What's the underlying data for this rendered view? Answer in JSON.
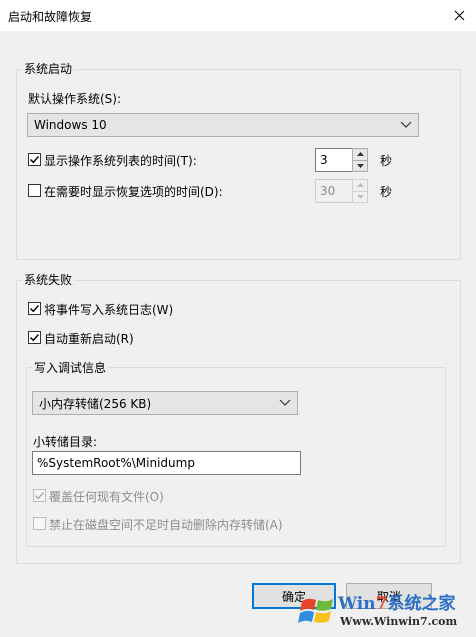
{
  "window": {
    "title": "启动和故障恢复",
    "close_icon": "close-icon"
  },
  "system_startup": {
    "group_title": "系统启动",
    "default_os_label": "默认操作系统(S):",
    "default_os_value": "Windows 10",
    "show_os_list": {
      "label": "显示操作系统列表的时间(T):",
      "checked": true,
      "value": "3",
      "unit": "秒"
    },
    "show_recovery": {
      "label": "在需要时显示恢复选项的时间(D):",
      "checked": false,
      "value": "30",
      "unit": "秒"
    }
  },
  "system_failure": {
    "group_title": "系统失败",
    "write_event": {
      "label": "将事件写入系统日志(W)",
      "checked": true
    },
    "auto_restart": {
      "label": "自动重新启动(R)",
      "checked": true
    },
    "debug_info": {
      "group_title": "写入调试信息",
      "dump_type": "小内存转储(256 KB)",
      "dump_dir_label": "小转储目录:",
      "dump_dir_value": "%SystemRoot%\\Minidump",
      "overwrite": {
        "label": "覆盖任何现有文件(O)",
        "checked": true,
        "disabled": true
      },
      "disable_auto_delete": {
        "label": "禁止在磁盘空间不足时自动删除内存转储(A)",
        "checked": false,
        "disabled": true
      }
    }
  },
  "buttons": {
    "ok": "确定",
    "cancel": "取消"
  },
  "watermark": {
    "brand_w": "Win",
    "brand_7": "7",
    "brand_cn": "系统之家",
    "url": "Www.Winwin7.com"
  },
  "colors": {
    "accent": "#0078d7",
    "dialog_bg": "#f0f0f0",
    "disabled_text": "#8d8d8d"
  }
}
